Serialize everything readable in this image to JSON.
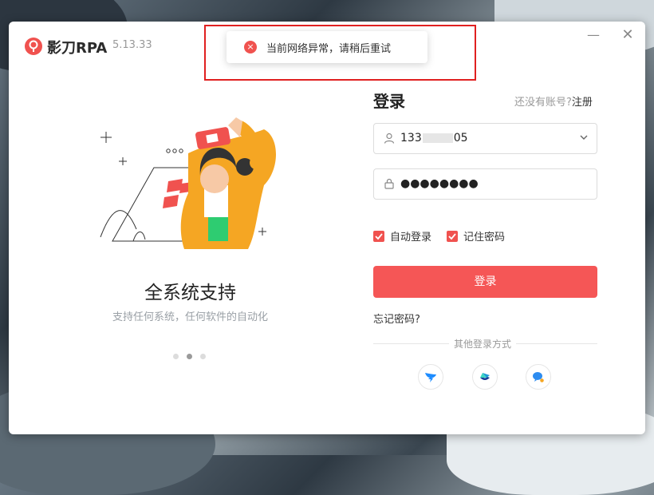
{
  "window": {
    "app_name": "影刀RPA",
    "version": "5.13.33",
    "minimize_glyph": "—",
    "close_glyph": "✕"
  },
  "toast": {
    "message": "当前网络异常，请稍后重试",
    "icon_glyph": "×",
    "icon_color": "#f0524f"
  },
  "carousel": {
    "title": "全系统支持",
    "subtitle": "支持任何系统，任何软件的自动化",
    "slide_count": 3,
    "active_slide": 2
  },
  "login": {
    "title": "登录",
    "no_account_text": "还没有账号?",
    "register_label": "注册",
    "username_prefix": "133",
    "username_suffix": "05",
    "password_mask": "●●●●●●●●",
    "auto_login_label": "自动登录",
    "remember_password_label": "记住密码",
    "auto_login_checked": true,
    "remember_password_checked": true,
    "submit_label": "登录",
    "forgot_label": "忘记密码?",
    "other_methods_label": "其他登录方式"
  },
  "colors": {
    "accent": "#f55656",
    "checkbox": "#f0524f",
    "dingtalk": "#1e8cff",
    "feishu": "#1c9ad6",
    "wecom": "#2d8cf0"
  }
}
